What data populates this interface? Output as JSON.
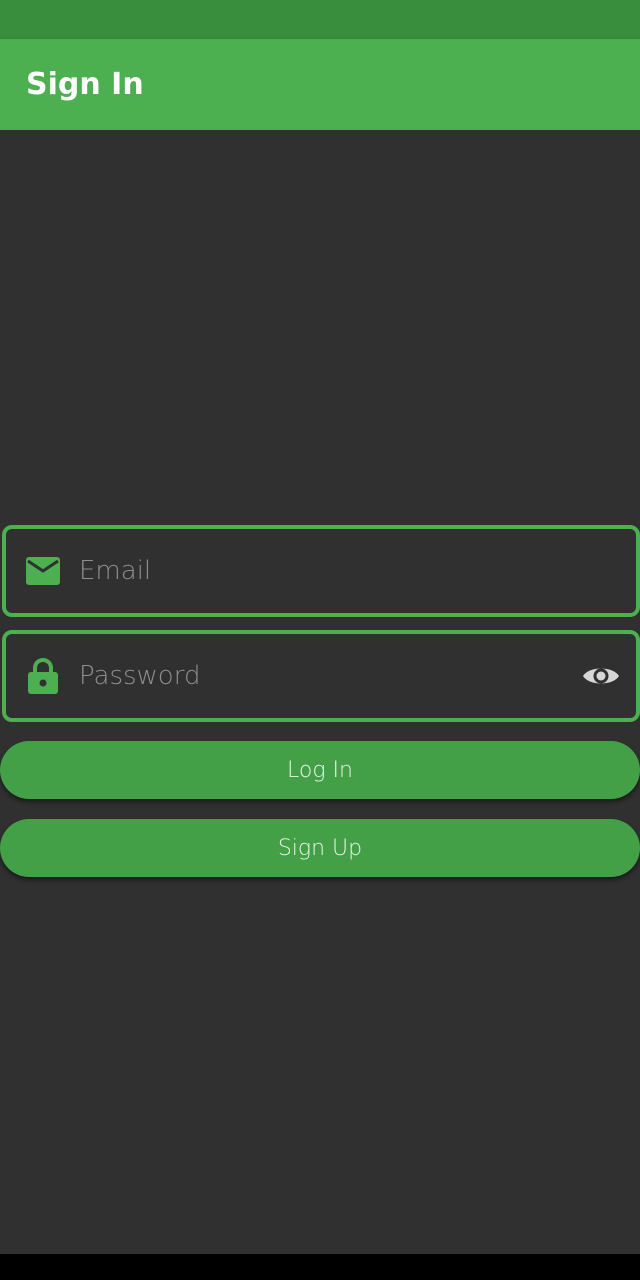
{
  "app_bar": {
    "title": "Sign In"
  },
  "form": {
    "email": {
      "placeholder": "Email",
      "value": "",
      "icon": "mail-icon"
    },
    "password": {
      "placeholder": "Password",
      "value": "",
      "icon": "lock-icon",
      "toggle_icon": "eye-icon"
    }
  },
  "buttons": {
    "login_label": "Log In",
    "signup_label": "Sign Up"
  },
  "colors": {
    "status_bar": "#388e3c",
    "app_bar": "#4caf50",
    "background": "#303030",
    "accent": "#4caf50",
    "button": "#43a047"
  }
}
